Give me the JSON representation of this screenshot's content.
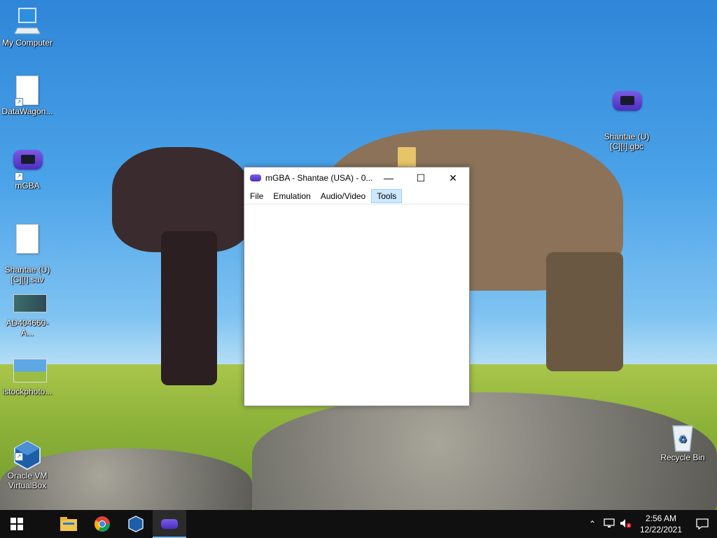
{
  "desktop": {
    "icons": [
      {
        "label": "My Computer",
        "icon": "computer-icon"
      },
      {
        "label": "DataWagon...",
        "icon": "file-icon"
      },
      {
        "label": "mGBA",
        "icon": "gba-icon"
      },
      {
        "label": "Shantae (U)\n[C][!].sav",
        "icon": "file-icon"
      },
      {
        "label": "AD404660-A...",
        "icon": "image-icon"
      },
      {
        "label": "istockphoto...",
        "icon": "image-icon"
      },
      {
        "label": "Oracle VM\nVirtualBox",
        "icon": "virtualbox-icon"
      },
      {
        "label": "Shantae (U)\n[C][!].gbc",
        "icon": "gba-icon"
      },
      {
        "label": "Recycle Bin",
        "icon": "recycle-bin-icon"
      }
    ]
  },
  "window": {
    "title": "mGBA - Shantae (USA) - 0....",
    "controls": {
      "minimize": "—",
      "maximize": "☐",
      "close": "✕"
    },
    "menu": [
      "File",
      "Emulation",
      "Audio/Video",
      "Tools"
    ]
  },
  "taskbar": {
    "apps": [
      "start-icon",
      "file-explorer-icon",
      "chrome-icon",
      "virtualbox-icon",
      "mgba-icon"
    ],
    "tray": {
      "time": "2:56 AM",
      "date": "12/22/2021"
    }
  }
}
